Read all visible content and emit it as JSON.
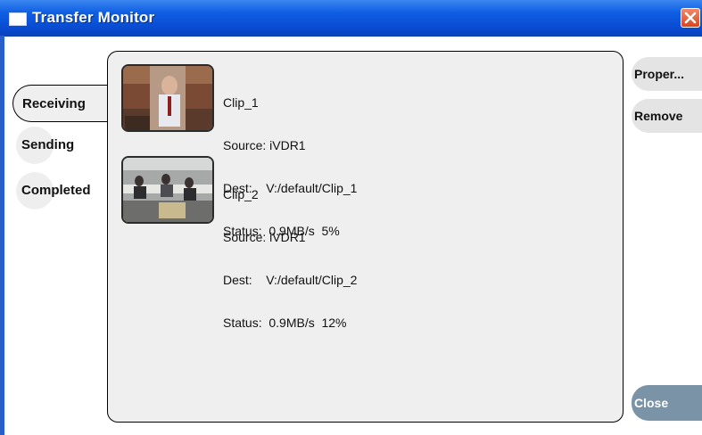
{
  "window": {
    "title": "Transfer Monitor"
  },
  "tabs": [
    {
      "label": "Receiving",
      "selected": true
    },
    {
      "label": "Sending",
      "selected": false
    },
    {
      "label": "Completed",
      "selected": false
    }
  ],
  "clips": [
    {
      "name": "Clip_1",
      "source": "Source: iVDR1",
      "dest": "Dest:    V:/default/Clip_1",
      "status": "Status:  0.9MB/s  5%"
    },
    {
      "name": "Clip_2",
      "source": "Source: iVDR1",
      "dest": "Dest:    V:/default/Clip_2",
      "status": "Status:  0.9MB/s  12%"
    }
  ],
  "buttons": {
    "properties": "Proper...",
    "remove": "Remove",
    "close": "Close"
  },
  "colors": {
    "titlebar": "#0a4fd6",
    "panel": "#efefef",
    "close_button": "#7a93a6"
  }
}
